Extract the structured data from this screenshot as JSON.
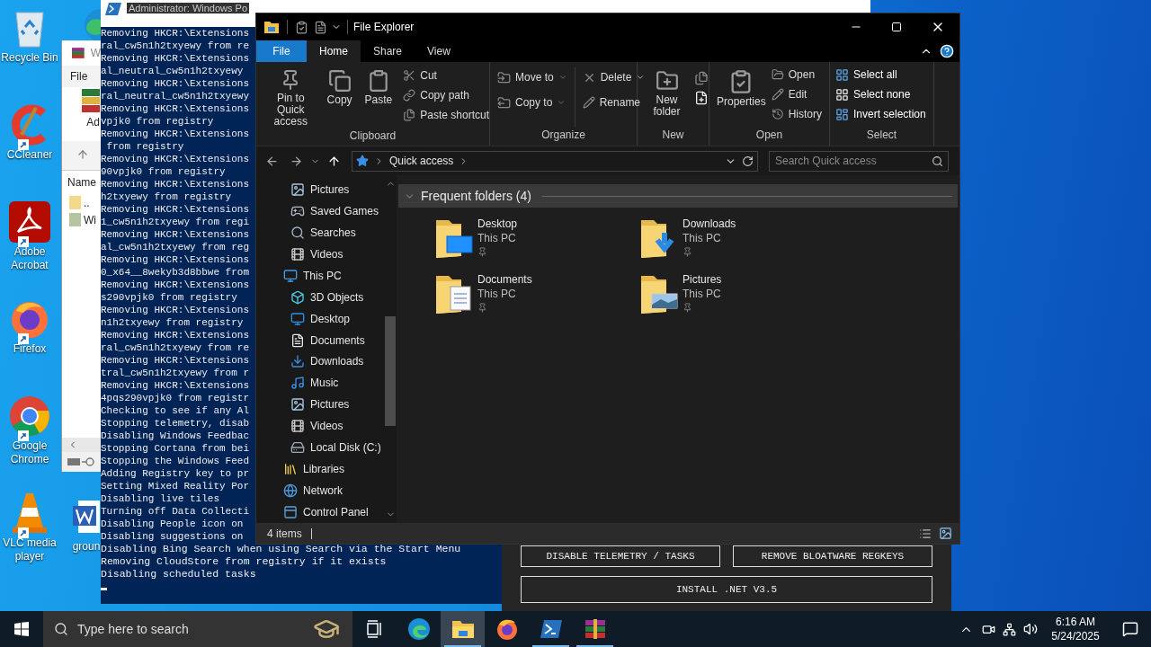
{
  "desktop_icons": [
    {
      "label": "Recycle Bin",
      "kind": "recycle",
      "shortcut": false
    },
    {
      "label": "CCleaner",
      "kind": "ccleaner",
      "shortcut": true
    },
    {
      "label": "Adobe Acrobat",
      "kind": "acrobat",
      "shortcut": true
    },
    {
      "label": "Firefox",
      "kind": "firefox",
      "shortcut": true
    },
    {
      "label": "Google Chrome",
      "kind": "chrome",
      "shortcut": true
    },
    {
      "label": "VLC media player",
      "kind": "vlc",
      "shortcut": true
    }
  ],
  "desktop_file": {
    "label": "groun"
  },
  "winrar_window": {
    "title": "W",
    "menu": "File",
    "toolbar_label": "Ad",
    "column": "Name",
    "rows": [
      "..",
      "Wi"
    ]
  },
  "powershell": {
    "title": "Administrator: Windows Po",
    "lines": [
      "Removing HKCR:\\Extensions",
      "ral_cw5n1h2txyewy from re",
      "Removing HKCR:\\Extensions",
      "al_neutral_cw5n1h2txyewy",
      "Removing HKCR:\\Extensions",
      "ral_neutral_cw5n1h2txyewy",
      "Removing HKCR:\\Extensions",
      "vpjk0 from registry",
      "Removing HKCR:\\Extensions",
      " from registry",
      "Removing HKCR:\\Extensions",
      "90vpjk0 from registry",
      "Removing HKCR:\\Extensions",
      "h2txyewy from registry",
      "Removing HKCR:\\Extensions",
      "1_cw5n1h2txyewy from regi",
      "Removing HKCR:\\Extensions",
      "al_cw5n1h2txyewy from reg",
      "Removing HKCR:\\Extensions",
      "0_x64__8wekyb3d8bbwe from",
      "Removing HKCR:\\Extensions",
      "s290vpjk0 from registry",
      "Removing HKCR:\\Extensions",
      "n1h2txyewy from registry",
      "Removing HKCR:\\Extensions",
      "ral_cw5n1h2txyewy from re",
      "Removing HKCR:\\Extensions",
      "tral_cw5n1h2txyewy from r",
      "Removing HKCR:\\Extensions",
      "4pqs290vpjk0 from registr",
      "Checking to see if any Al",
      "Stopping telemetry, disab",
      "Disabling Windows Feedbac",
      "Stopping Cortana from bei",
      "Stopping the Windows Feed",
      "Adding Registry key to pr",
      "Setting Mixed Reality Por",
      "Disabling live tiles",
      "Turning off Data Collecti",
      "Disabling People icon on",
      "Disabling suggestions on"
    ],
    "full_lines": [
      "Disabling Bing Search when using Search via the Start Menu",
      "Removing CloudStore from registry if it exists",
      "Disabling scheduled tasks"
    ]
  },
  "dialog": {
    "buttons": [
      "DISABLE TELEMETRY / TASKS",
      "REMOVE BLOATWARE REGKEYS",
      "INSTALL .NET V3.5"
    ]
  },
  "explorer": {
    "title": "File Explorer",
    "tabs": [
      {
        "label": "File",
        "kind": "file",
        "selected": false
      },
      {
        "label": "Home",
        "kind": "tab",
        "selected": true
      },
      {
        "label": "Share",
        "kind": "tab",
        "selected": false
      },
      {
        "label": "View",
        "kind": "tab",
        "selected": false
      }
    ],
    "ribbon": [
      {
        "label": "Clipboard",
        "items": [
          "Pin to Quick access",
          "Copy",
          "Paste",
          "Cut",
          "Copy path",
          "Paste shortcut"
        ]
      },
      {
        "label": "Organize",
        "items": [
          "Move to",
          "Copy to",
          "Delete",
          "Rename"
        ]
      },
      {
        "label": "New",
        "items": [
          "New folder"
        ]
      },
      {
        "label": "Open",
        "items": [
          "Properties",
          "Open",
          "Edit",
          "History"
        ]
      },
      {
        "label": "Select",
        "items": [
          "Select all",
          "Select none",
          "Invert selection"
        ]
      }
    ],
    "address": "Quick access",
    "search_placeholder": "Search Quick access",
    "nav": [
      {
        "children": [
          {
            "label": "Pictures",
            "kind": "pictures"
          },
          {
            "label": "Saved Games",
            "kind": "games"
          },
          {
            "label": "Searches",
            "kind": "search"
          },
          {
            "label": "Videos",
            "kind": "videos"
          }
        ]
      },
      {
        "label": "This PC",
        "kind": "pc",
        "children": [
          {
            "label": "3D Objects",
            "kind": "objects"
          },
          {
            "label": "Desktop",
            "kind": "desktop"
          },
          {
            "label": "Documents",
            "kind": "documents"
          },
          {
            "label": "Downloads",
            "kind": "downloads"
          },
          {
            "label": "Music",
            "kind": "music"
          },
          {
            "label": "Pictures",
            "kind": "pictures"
          },
          {
            "label": "Videos",
            "kind": "videos"
          },
          {
            "label": "Local Disk (C:)",
            "kind": "disk"
          }
        ]
      },
      {
        "label": "Libraries",
        "kind": "libraries"
      },
      {
        "label": "Network",
        "kind": "network"
      },
      {
        "label": "Control Panel",
        "kind": "control"
      }
    ],
    "section": "Frequent folders (4)",
    "folders": [
      {
        "name": "Desktop",
        "location": "This PC",
        "kind": "desktop"
      },
      {
        "name": "Downloads",
        "location": "This PC",
        "kind": "downloads"
      },
      {
        "name": "Documents",
        "location": "This PC",
        "kind": "documents"
      },
      {
        "name": "Pictures",
        "location": "This PC",
        "kind": "pictures"
      }
    ],
    "status": "4 items"
  },
  "taskbar": {
    "search_placeholder": "Type here to search",
    "apps": [
      {
        "kind": "taskview",
        "running": false,
        "active": false
      },
      {
        "kind": "edge",
        "running": false,
        "active": false
      },
      {
        "kind": "explorer",
        "running": true,
        "active": true
      },
      {
        "kind": "firefox",
        "running": false,
        "active": false
      },
      {
        "kind": "powershell",
        "running": true,
        "active": false
      },
      {
        "kind": "winrar",
        "running": true,
        "active": false
      }
    ],
    "time": "6:16 AM",
    "date": "5/24/2025"
  }
}
